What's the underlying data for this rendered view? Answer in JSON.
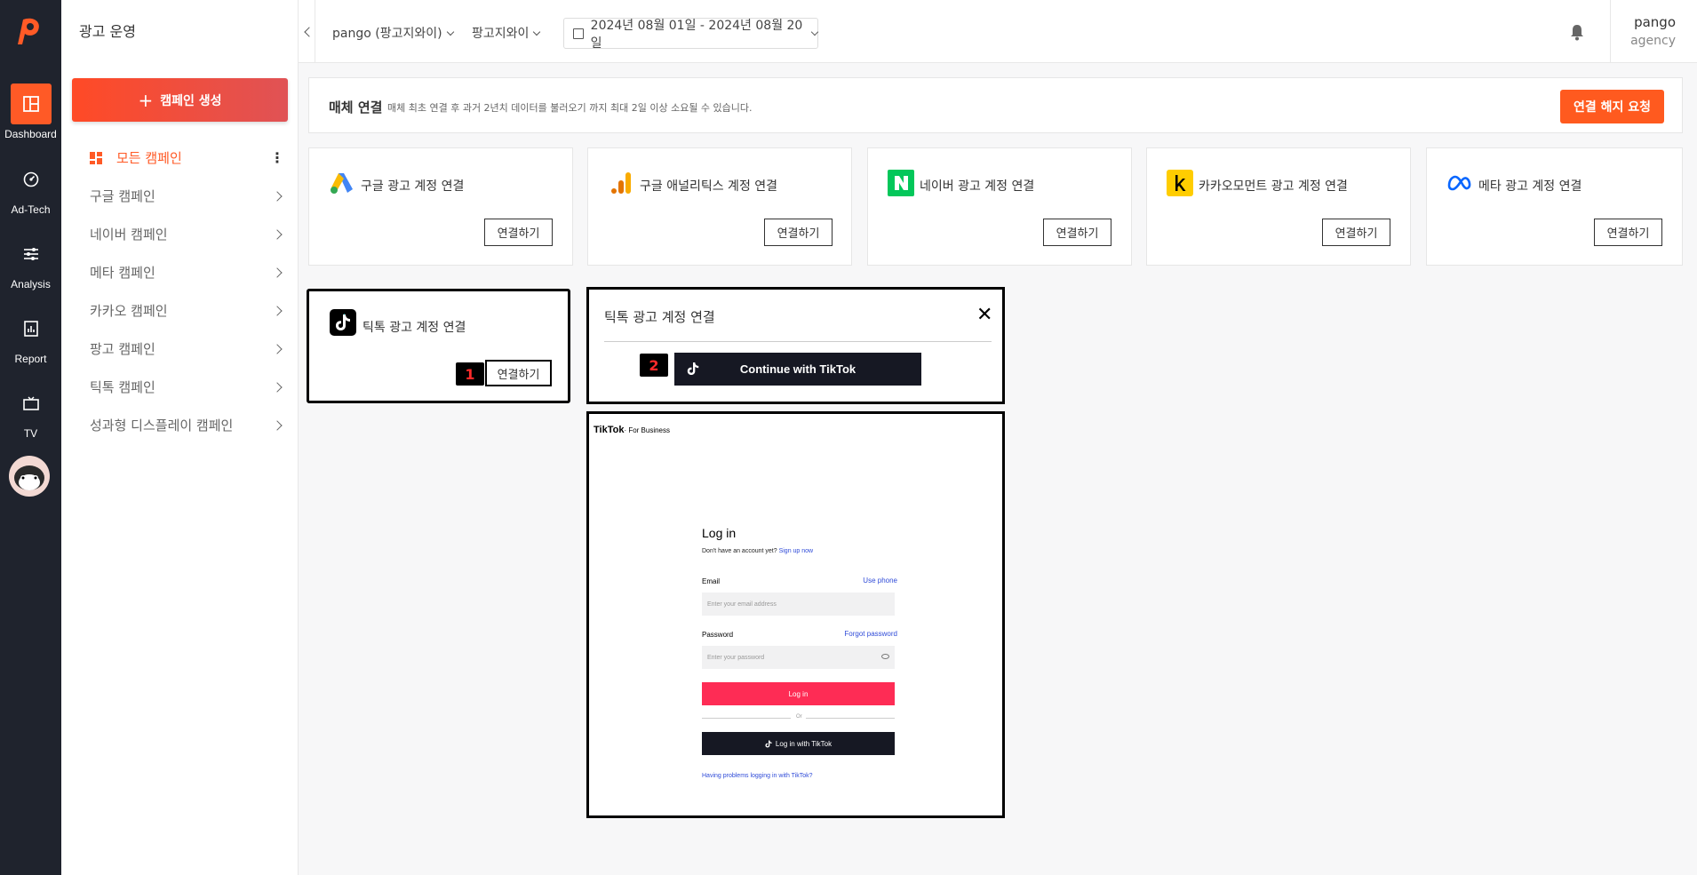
{
  "rail": {
    "items": [
      {
        "label": "Dashboard"
      },
      {
        "label": "Ad-Tech"
      },
      {
        "label": "Analysis"
      },
      {
        "label": "Report"
      },
      {
        "label": "TV"
      }
    ]
  },
  "sidebar": {
    "title": "광고 운영",
    "create_label": "캠페인 생성",
    "items": [
      {
        "label": "모든 캠페인"
      },
      {
        "label": "구글 캠페인"
      },
      {
        "label": "네이버 캠페인"
      },
      {
        "label": "메타 캠페인"
      },
      {
        "label": "카카오 캠페인"
      },
      {
        "label": "팡고 캠페인"
      },
      {
        "label": "틱톡 캠페인"
      },
      {
        "label": "성과형 디스플레이 캠페인"
      }
    ]
  },
  "header": {
    "account": "pango (팡고지와이)",
    "sub_account": "팡고지와이",
    "date_range": "2024년 08월 01일 - 2024년 08월 20일",
    "user_name": "pango",
    "user_role": "agency"
  },
  "banner": {
    "title": "매체 연결",
    "desc": "매체 최초 연결 후 과거 2년치 데이터를 불러오기 까지 최대 2일 이상 소요될 수 있습니다.",
    "disconnect_label": "연결 해지 요청"
  },
  "cards": [
    {
      "title": "구글 광고 계정 연결",
      "button": "연결하기",
      "icon": "google-ads-icon"
    },
    {
      "title": "구글 애널리틱스 계정 연결",
      "button": "연결하기",
      "icon": "google-analytics-icon"
    },
    {
      "title": "네이버 광고 계정 연결",
      "button": "연결하기",
      "icon": "naver-icon"
    },
    {
      "title": "카카오모먼트 광고 계정 연결",
      "button": "연결하기",
      "icon": "kakao-icon"
    },
    {
      "title": "메타 광고 계정 연결",
      "button": "연결하기",
      "icon": "meta-icon"
    }
  ],
  "tiktok_card": {
    "title": "틱톡 광고 계정 연결",
    "button": "연결하기",
    "badge": "1"
  },
  "popup": {
    "title": "틱톡 광고 계정 연결",
    "close": "✕",
    "badge": "2",
    "continue_label": "Continue with TikTok"
  },
  "login": {
    "brand": "TikTok",
    "brand_suffix": "· For Business",
    "heading": "Log in",
    "no_account": "Don't have an account yet?",
    "signup": "Sign up now",
    "email_label": "Email",
    "use_phone": "Use phone",
    "email_placeholder": "Enter your email address",
    "password_label": "Password",
    "forgot": "Forgot password",
    "password_placeholder": "Enter your password",
    "login_button": "Log in",
    "or": "Or",
    "tiktok_login": "Log in with TikTok",
    "help": "Having problems logging in with TikTok?"
  },
  "colors": {
    "accent": "#ff5a26",
    "rail": "#1f232d",
    "tiktok_pink": "#fe2c55"
  }
}
